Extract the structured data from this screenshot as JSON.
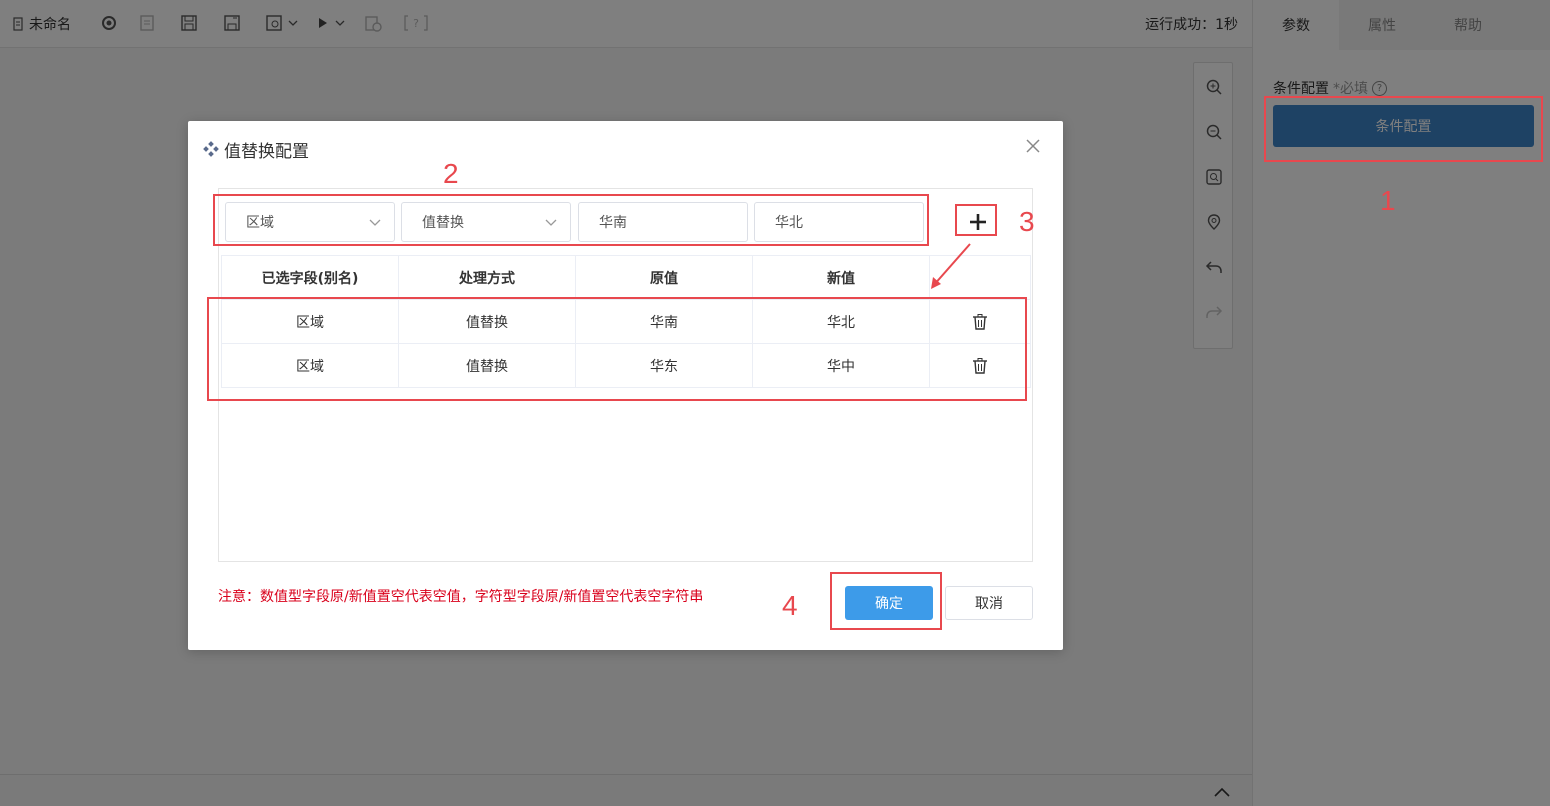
{
  "toolbar": {
    "file_name": "未命名",
    "run_status": "运行成功：1秒"
  },
  "right_panel": {
    "tabs": [
      {
        "label": "参数",
        "active": true
      },
      {
        "label": "属性",
        "active": false
      },
      {
        "label": "帮助",
        "active": false
      }
    ],
    "condition_label": "条件配置",
    "required_hint": "*必填",
    "condition_button": "条件配置"
  },
  "dialog": {
    "title": "值替换配置",
    "inputs": {
      "field_select": "区域",
      "method_select": "值替换",
      "old_value": "华南",
      "new_value": "华北"
    },
    "table": {
      "headers": [
        "已选字段(别名)",
        "处理方式",
        "原值",
        "新值"
      ],
      "rows": [
        [
          "区域",
          "值替换",
          "华南",
          "华北"
        ],
        [
          "区域",
          "值替换",
          "华东",
          "华中"
        ]
      ]
    },
    "notice": "注意：数值型字段原/新值置空代表空值，字符型字段原/新值置空代表空字符串",
    "ok_button": "确定",
    "cancel_button": "取消"
  },
  "annotations": {
    "n1": "1",
    "n2": "2",
    "n3": "3",
    "n4": "4",
    "color": "#e8484e"
  },
  "colors": {
    "primary_button": "#3d9be9",
    "panel_button": "#3d85c8",
    "notice_text": "#d9001b"
  }
}
